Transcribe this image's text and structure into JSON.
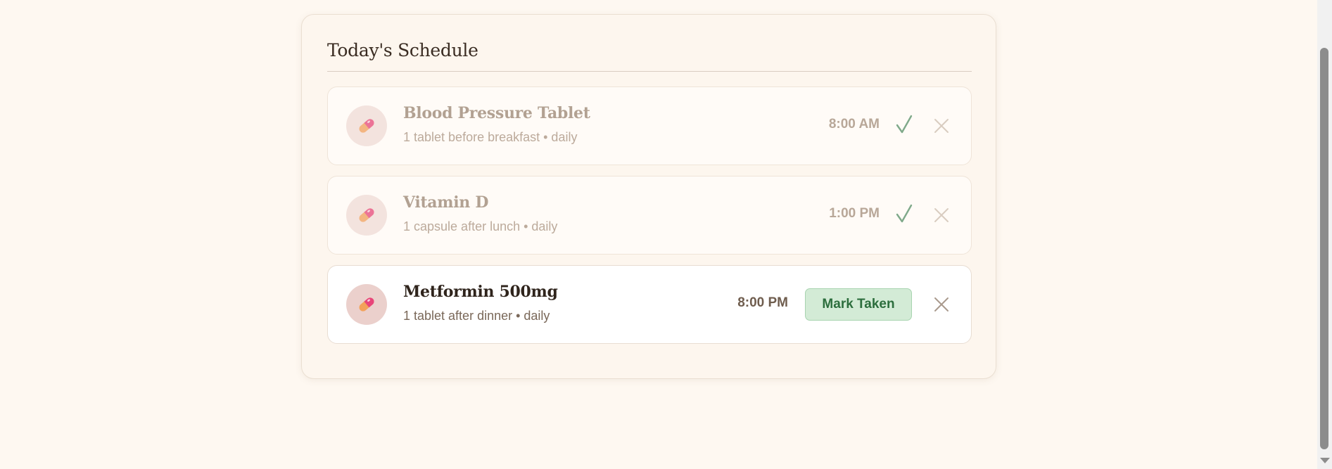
{
  "schedule": {
    "title": "Today's Schedule",
    "medications": [
      {
        "name": "Blood Pressure Tablet",
        "description": "1 tablet before breakfast • daily",
        "time": "8:00 AM",
        "status": "taken"
      },
      {
        "name": "Vitamin D",
        "description": "1 capsule after lunch • daily",
        "time": "1:00 PM",
        "status": "taken"
      },
      {
        "name": "Metformin 500mg",
        "description": "1 tablet after dinner • daily",
        "time": "8:00 PM",
        "status": "pending",
        "action_label": "Mark Taken"
      }
    ]
  },
  "icons": {
    "medication": "pill-icon",
    "taken": "check-icon",
    "remove": "close-icon"
  },
  "colors": {
    "page_background": "#fef8f1",
    "taken_check": "#7fa98a",
    "mark_button_bg": "#d3ebd6",
    "mark_button_text": "#2c6e3d",
    "pill_pink": "#e8457a",
    "pill_orange": "#f3a25a"
  }
}
